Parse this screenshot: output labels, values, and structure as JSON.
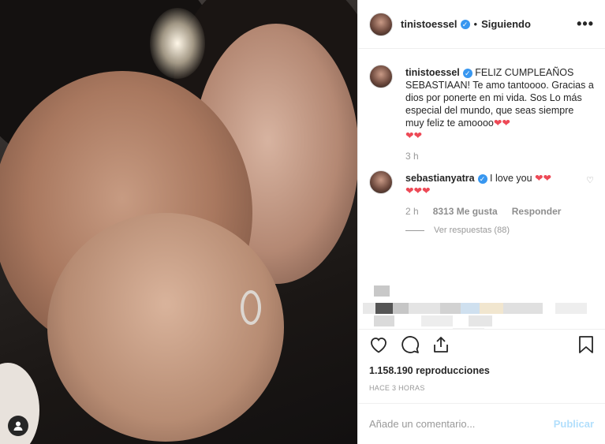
{
  "header": {
    "username": "tinistoessel",
    "dot": "•",
    "follow_status": "Siguiendo",
    "more": "•••"
  },
  "caption": {
    "username": "tinistoessel",
    "text": "FELIZ CUMPLEAÑOS SEBASTIAAN! Te amo tantoooo. Gracias a dios por ponerte en mi vida. Sos Lo más especial del mundo, que seas siempre muy feliz te amoooo",
    "hearts": "❤❤",
    "hearts2": "❤❤",
    "time": "3 h"
  },
  "comment": {
    "username": "sebastianyatra",
    "text": "I love you",
    "hearts": "❤❤",
    "hearts2": "❤❤❤",
    "time": "2 h",
    "likes": "8313 Me gusta",
    "reply": "Responder",
    "view_replies": "Ver respuestas (88)"
  },
  "icons": {
    "heart": "heart-icon",
    "comment": "comment-icon",
    "share": "share-icon",
    "save": "bookmark-icon",
    "user": "user-icon"
  },
  "views": "1.158.190 reproducciones",
  "posted_ago": "HACE 3 HORAS",
  "add_comment": {
    "placeholder": "Añade un comentario...",
    "publish": "Publicar"
  },
  "colors": {
    "verified": "#3897f0",
    "heart": "#ed4956",
    "publish_disabled": "#b2dffc"
  }
}
